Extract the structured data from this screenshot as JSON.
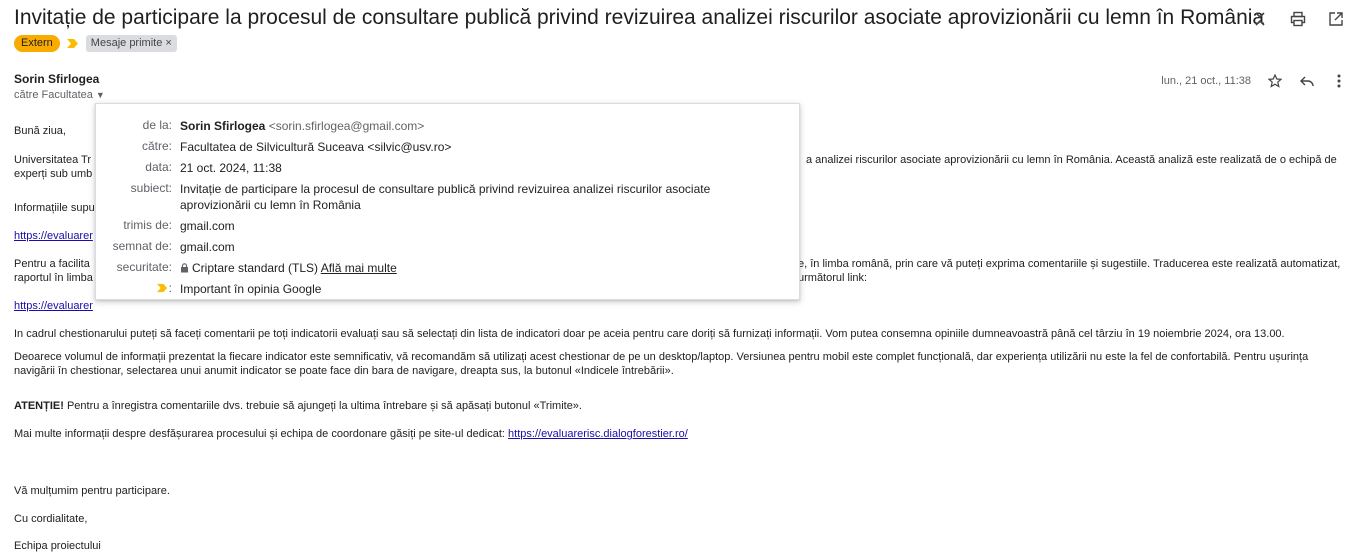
{
  "subject": "Invitație de participare la procesul de consultare publică privind revizuirea analizei riscurilor asociate aprovizionării cu lemn în România",
  "labels": {
    "extern": "Extern",
    "inbox": "Mesaje primite",
    "inbox_remove": "×"
  },
  "colors": {
    "extern_badge": "#f9ab00",
    "importance_marker": "#fbbc04",
    "link": "#1a0dab"
  },
  "top_icons": [
    "collapse-icon",
    "print-icon",
    "open-new-window-icon"
  ],
  "sender": {
    "name": "Sorin Sfirlogea",
    "recipient_line": "către Facultatea"
  },
  "meta": {
    "date": "lun., 21 oct., 11:38"
  },
  "body": {
    "greeting": "Bună ziua,",
    "p1_start": "Universitatea Tr",
    "p1_end": "a analizei riscurilor asociate aprovizionării cu lemn în România. Această analiză este realizată de o echipă de",
    "p1_line2": "experți sub umb",
    "p2": "Informațiile supu",
    "link1": "https://evaluarer",
    "p3_start": "Pentru a facilita",
    "p3_end": "e, în limba română, prin care vă puteți exprima comentariile și sugestiile. Traducerea este realizată automatizat,",
    "p3_line2": "raportul în limba",
    "p3_line2_end": "următorul link:",
    "link2": "https://evaluarer",
    "p4": "In cadrul chestionarului puteți să faceți comentarii pe toți indicatorii evaluați sau să selectați din lista de indicatori doar pe aceia pentru care doriți să furnizați informații. Vom putea consemna opiniile dumneavoastră până cel târziu în 19 noiembrie 2024, ora 13.00.",
    "p5": "Deoarece volumul de informații prezentat la fiecare indicator este semnificativ, vă recomandăm să utilizați acest chestionar de pe un desktop/laptop. Versiunea pentru mobil este complet funcțională, dar experiența utilizării nu este la fel de confortabilă. Pentru ușurința navigării în chestionar, selectarea unui anumit indicator se poate face din bara de navigare, dreapta sus, la butonul «Indicele întrebării».",
    "p6_bold": "ATENȚIE!",
    "p6_rest": " Pentru a înregistra comentariile dvs. trebuie să ajungeți la ultima întrebare și să apăsați butonul «Trimite».",
    "p7_text": "Mai multe informații despre desfășurarea procesului și echipa de coordonare găsiți pe site-ul dedicat: ",
    "p7_link": "https://evaluarerisc.dialogforestier.ro/",
    "thanks": "Vă mulțumim pentru participare.",
    "regards": "Cu cordialitate,",
    "signature": "Echipa proiectului"
  },
  "details_popup": {
    "from_label": "de la:",
    "from_name": "Sorin Sfirlogea",
    "from_email": "<sorin.sfirlogea@gmail.com>",
    "to_label": "către:",
    "to_value": "Facultatea de Silvicultură Suceava <silvic@usv.ro>",
    "date_label": "data:",
    "date_value": "21 oct. 2024, 11:38",
    "subject_label": "subiect:",
    "subject_line1": "Invitație de participare la procesul de consultare publică privind revizuirea analizei riscurilor asociate",
    "subject_line2": "aprovizionării cu lemn în România",
    "mailed_by_label": "trimis de:",
    "mailed_by_value": "gmail.com",
    "signed_by_label": "semnat de:",
    "signed_by_value": "gmail.com",
    "security_label": "securitate:",
    "security_value": "Criptare standard (TLS)",
    "security_link": "Află mai multe",
    "importance_label": ":",
    "importance_value": "Important în opinia Google"
  }
}
